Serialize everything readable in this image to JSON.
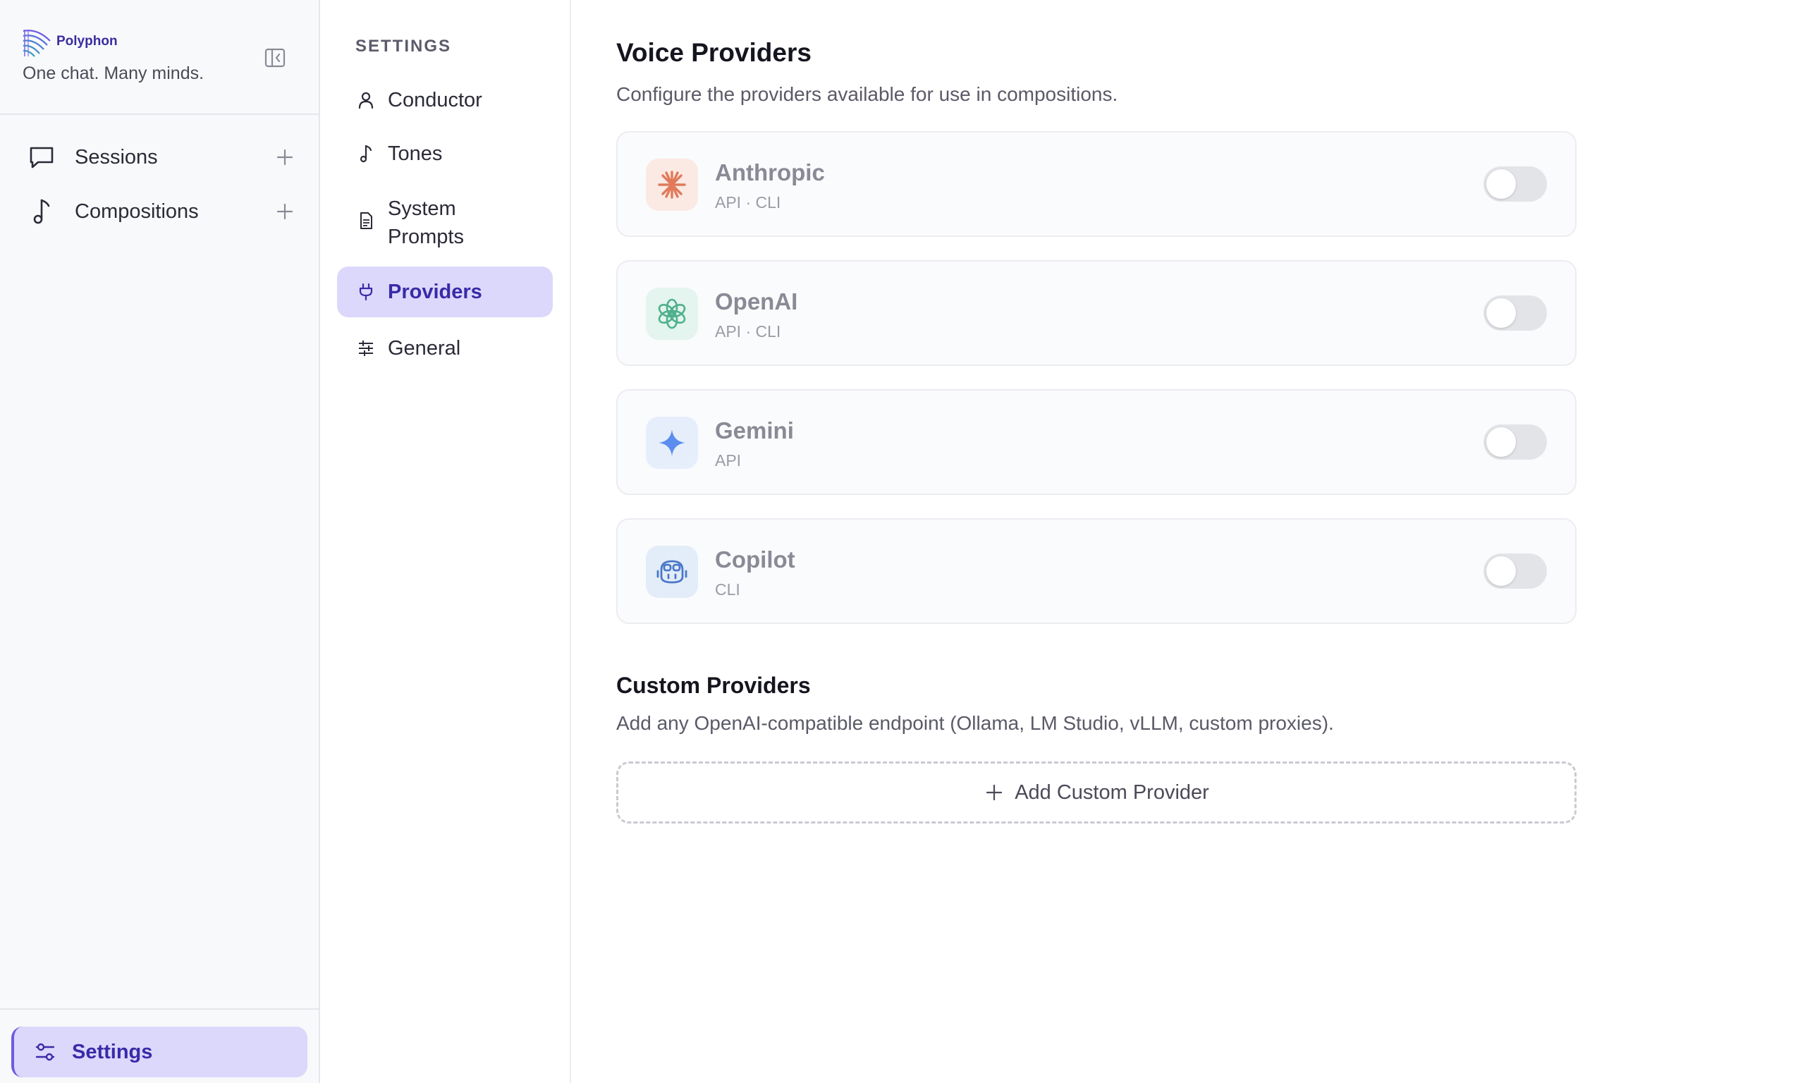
{
  "sidebar": {
    "brand_name": "Polyphon",
    "tagline": "One chat. Many minds.",
    "nav": [
      {
        "label": "Sessions",
        "icon": "chat-bubble-icon"
      },
      {
        "label": "Compositions",
        "icon": "music-note-icon"
      }
    ],
    "settings_label": "Settings"
  },
  "settings_nav": {
    "heading": "SETTINGS",
    "items": [
      {
        "label": "Conductor",
        "icon": "person-icon"
      },
      {
        "label": "Tones",
        "icon": "music-note-icon"
      },
      {
        "label": "System Prompts",
        "icon": "document-icon"
      },
      {
        "label": "Providers",
        "icon": "plug-icon",
        "active": true
      },
      {
        "label": "General",
        "icon": "sliders-icon"
      }
    ]
  },
  "main": {
    "title": "Voice Providers",
    "subtitle": "Configure the providers available for use in compositions.",
    "providers": [
      {
        "name": "Anthropic",
        "modes": "API · CLI",
        "enabled": false,
        "icon": "anthropic-sunburst-icon",
        "color": "#e07a5a"
      },
      {
        "name": "OpenAI",
        "modes": "API · CLI",
        "enabled": false,
        "icon": "openai-knot-icon",
        "color": "#4fb08c"
      },
      {
        "name": "Gemini",
        "modes": "API",
        "enabled": false,
        "icon": "gemini-sparkle-icon",
        "color": "#5b8def"
      },
      {
        "name": "Copilot",
        "modes": "CLI",
        "enabled": false,
        "icon": "copilot-robot-icon",
        "color": "#4a78c8"
      }
    ],
    "custom_title": "Custom Providers",
    "custom_subtitle": "Add any OpenAI-compatible endpoint (Ollama, LM Studio, vLLM, custom proxies).",
    "add_custom_label": "Add Custom Provider"
  },
  "colors": {
    "accent": "#6c5ce0",
    "accent_bg": "#dcd8fb",
    "accent_text": "#3a2aa8"
  }
}
